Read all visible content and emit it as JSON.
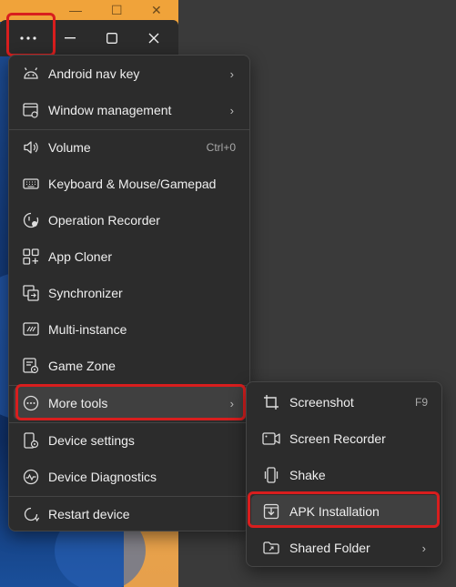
{
  "titlebar": {
    "more_icon": "more-horizontal-icon",
    "minimize_icon": "minimize-icon",
    "maximize_icon": "maximize-icon",
    "close_icon": "close-icon"
  },
  "menu": {
    "items": [
      {
        "label": "Android nav key",
        "icon": "android-icon",
        "has_submenu": true
      },
      {
        "label": "Window management",
        "icon": "window-gear-icon",
        "has_submenu": true
      },
      {
        "label": "Volume",
        "icon": "speaker-icon",
        "shortcut": "Ctrl+0"
      },
      {
        "label": "Keyboard & Mouse/Gamepad",
        "icon": "keyboard-icon"
      },
      {
        "label": "Operation Recorder",
        "icon": "recorder-icon"
      },
      {
        "label": "App Cloner",
        "icon": "app-cloner-icon"
      },
      {
        "label": "Synchronizer",
        "icon": "synchronizer-icon"
      },
      {
        "label": "Multi-instance",
        "icon": "multi-instance-icon"
      },
      {
        "label": "Game Zone",
        "icon": "game-zone-icon"
      },
      {
        "label": "More tools",
        "icon": "more-circle-icon",
        "has_submenu": true,
        "active": true
      },
      {
        "label": "Device settings",
        "icon": "device-settings-icon"
      },
      {
        "label": "Device Diagnostics",
        "icon": "diagnostics-icon"
      },
      {
        "label": "Restart device",
        "icon": "restart-icon"
      }
    ]
  },
  "submenu": {
    "items": [
      {
        "label": "Screenshot",
        "icon": "crop-icon",
        "shortcut": "F9"
      },
      {
        "label": "Screen Recorder",
        "icon": "video-camera-icon"
      },
      {
        "label": "Shake",
        "icon": "shake-icon"
      },
      {
        "label": "APK Installation",
        "icon": "apk-install-icon",
        "active": true
      },
      {
        "label": "Shared Folder",
        "icon": "shared-folder-icon",
        "has_submenu": true
      }
    ]
  },
  "colors": {
    "highlight": "#d81e1e",
    "menu_bg": "#2c2c2c",
    "active_bg": "#404040",
    "accent_orange": "#f0a33a"
  }
}
